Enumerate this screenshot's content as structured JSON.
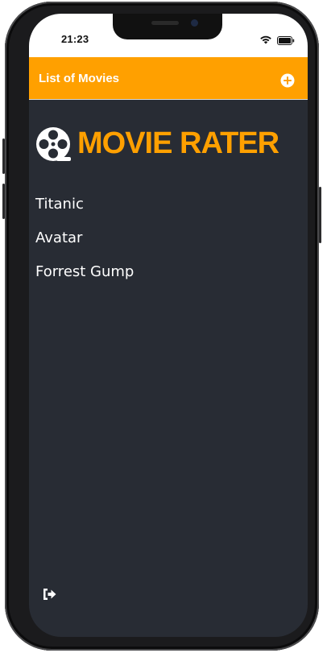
{
  "status_bar": {
    "time": "21:23",
    "icons": [
      "wifi-icon",
      "battery-icon"
    ]
  },
  "header": {
    "title": "List of Movies",
    "add_icon": "plus-circle-icon"
  },
  "logo": {
    "icon": "film-reel-icon",
    "text": "MOVIE RATER"
  },
  "movies": [
    {
      "title": "Titanic"
    },
    {
      "title": "Avatar"
    },
    {
      "title": "Forrest Gump"
    }
  ],
  "footer": {
    "logout_icon": "sign-out-icon"
  },
  "colors": {
    "accent": "#ffa000",
    "background": "#282c34",
    "text": "#ffffff"
  }
}
